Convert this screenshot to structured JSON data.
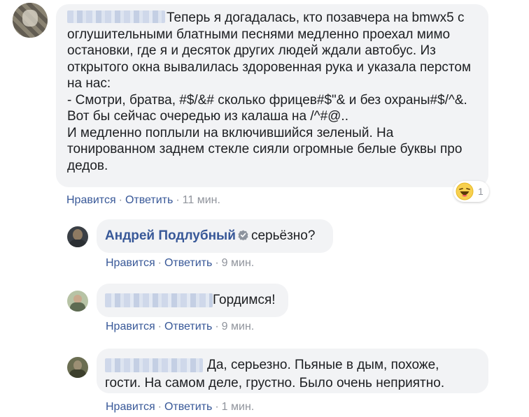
{
  "main_comment": {
    "text": "Теперь я догадалась, кто позавчера на bmwx5 с оглушительными блатными песнями медленно проехал мимо остановки, где я и десяток других людей ждали автобус. Из открытого окна вывалилась здоровенная рука и указала перстом на нас:\n- Смотри, братва, #$/&# сколько фрицев#$\"& и без охраны#$/^&. Вот бы сейчас очередью из калаша на /^#@..\nИ медленно поплыли на включившийся зеленый. На тонированном заднем стекле сияли огромные белые буквы про дедов.",
    "like": "Нравится",
    "reply": "Ответить",
    "time": "11 мин.",
    "reaction_count": "1"
  },
  "replies": [
    {
      "author": "Андрей Подлубный",
      "text": "серьёзно?",
      "like": "Нравится",
      "reply": "Ответить",
      "time": "9 мин."
    },
    {
      "text": "Гордимся!",
      "like": "Нравится",
      "reply": "Ответить",
      "time": "9 мин."
    },
    {
      "text": "Да, серьезно. Пьяные в дым, похоже, гости. На самом деле, грустно. Было очень неприятно.",
      "like": "Нравится",
      "reply": "Ответить",
      "time": "1 мин."
    }
  ],
  "separator": "·",
  "icons": {
    "verified": "verified-badge-icon",
    "reaction": "haha-emoji-icon"
  },
  "colors": {
    "link": "#385898",
    "bubble": "#f2f3f5",
    "meta": "#90949c"
  }
}
